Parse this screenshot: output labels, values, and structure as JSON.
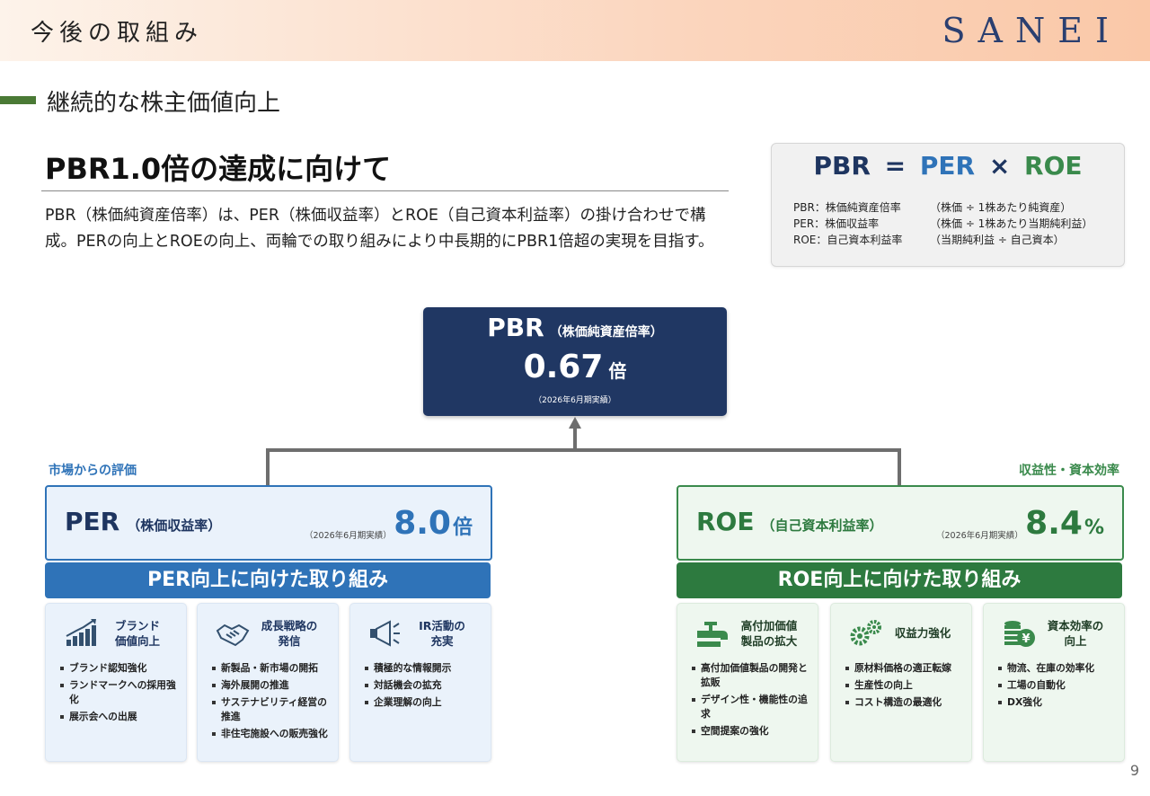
{
  "header": {
    "title": "今後の取組み",
    "logo": "SANEI"
  },
  "section": {
    "title": "継続的な株主価値向上"
  },
  "main": {
    "heading": "PBR1.0倍の達成に向けて",
    "intro": "PBR（株価純資産倍率）は、PER（株価収益率）とROE（自己資本利益率）の掛け合わせで構成。PERの向上とROEの向上、両輪での取り組みにより中長期的にPBR1倍超の実現を目指す。"
  },
  "formula": {
    "pbr": "PBR",
    "eq": "=",
    "per": "PER",
    "times": "×",
    "roe": "ROE",
    "definitions": [
      {
        "name": "PBR：株価純資産倍率",
        "formula": "（株価 ÷ 1株あたり純資産）"
      },
      {
        "name": "PER：株価収益率",
        "formula": "（株価 ÷ 1株あたり当期純利益）"
      },
      {
        "name": "ROE：自己資本利益率",
        "formula": "（当期純利益 ÷ 自己資本）"
      }
    ]
  },
  "pbr_box": {
    "label": "PBR",
    "sub_label": "（株価純資産倍率）",
    "value": "0.67",
    "unit": "倍",
    "note": "（2026年6月期実績）"
  },
  "per_side": {
    "category": "市場からの評価",
    "label": "PER",
    "sub_label": "（株価収益率）",
    "note": "（2026年6月期実績）",
    "value": "8.0",
    "unit": "倍",
    "band": "PER向上に向けた取り組み",
    "cards": [
      {
        "icon": "bar-chart-icon",
        "title": "ブランド\n価値向上",
        "items": [
          "ブランド認知強化",
          "ランドマークへの採用強化",
          "展示会への出展"
        ]
      },
      {
        "icon": "handshake-icon",
        "title": "成長戦略の\n発信",
        "items": [
          "新製品・新市場の開拓",
          "海外展開の推進",
          "サステナビリティ経営の推進",
          "非住宅施設への販売強化"
        ]
      },
      {
        "icon": "megaphone-icon",
        "title": "IR活動の\n充実",
        "items": [
          "積極的な情報開示",
          "対話機会の拡充",
          "企業理解の向上"
        ]
      }
    ]
  },
  "roe_side": {
    "category": "収益性・資本効率",
    "label": "ROE",
    "sub_label": "（自己資本利益率）",
    "note": "（2026年6月期実績）",
    "value": "8.4",
    "unit": "%",
    "band": "ROE向上に向けた取り組み",
    "cards": [
      {
        "icon": "faucet-icon",
        "title": "高付加価値\n製品の拡大",
        "items": [
          "高付加価値製品の開発と拡販",
          "デザイン性・機能性の追求",
          "空間提案の強化"
        ]
      },
      {
        "icon": "gears-icon",
        "title": "収益力強化",
        "items": [
          "原材料価格の適正転嫁",
          "生産性の向上",
          "コスト構造の最適化"
        ]
      },
      {
        "icon": "coins-yen-icon",
        "title": "資本効率の\n向上",
        "items": [
          "物流、在庫の効率化",
          "工場の自動化",
          "DX強化"
        ]
      }
    ]
  },
  "colors": {
    "navy": "#203763",
    "per_blue": "#2f73b8",
    "roe_green": "#2d7a3f",
    "section_green": "#4a7a35"
  },
  "page_number": "9"
}
